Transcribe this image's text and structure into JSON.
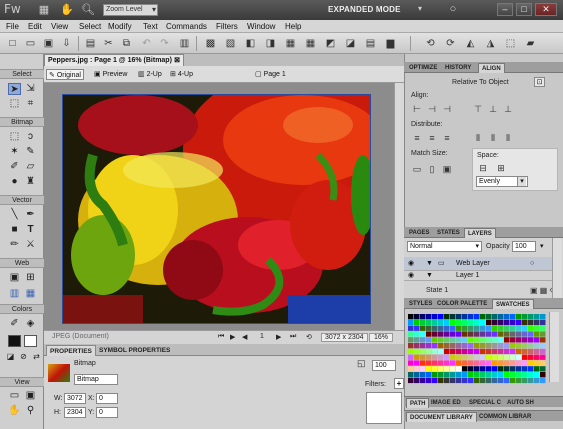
{
  "app": {
    "logo": "Fw",
    "zoom_select": "Zoom Level",
    "mode": "EXPANDED MODE"
  },
  "menu": [
    "File",
    "Edit",
    "View",
    "Select",
    "Modify",
    "Text",
    "Commands",
    "Filters",
    "Window",
    "Help"
  ],
  "document": {
    "tab_title": "Peppers.jpg : Page 1 @ 16% (Bitmap)",
    "views": {
      "original": "Original",
      "preview": "Preview",
      "two_up": "2-Up",
      "four_up": "4-Up"
    },
    "page": "Page 1"
  },
  "status": {
    "format": "JPEG (Document)",
    "page_num": "1",
    "size": "3072 x 2304",
    "zoom": "16%"
  },
  "tools": {
    "sections": [
      "Select",
      "Bitmap",
      "Vector",
      "Web",
      "Colors",
      "View"
    ]
  },
  "properties": {
    "tabs": [
      "PROPERTIES",
      "SYMBOL PROPERTIES"
    ],
    "type_label": "Bitmap",
    "name_value": "Bitmap",
    "w_label": "W:",
    "w": "3072",
    "x_label": "X:",
    "x": "0",
    "h_label": "H:",
    "h": "2304",
    "y_label": "Y:",
    "y": "0",
    "opacity": "100",
    "filters_label": "Filters:",
    "add": "+"
  },
  "right": {
    "top_tabs": [
      "OPTIMIZE",
      "HISTORY",
      "ALIGN"
    ],
    "relative": "Relative To Object",
    "align": "Align:",
    "distribute": "Distribute:",
    "match": "Match Size:",
    "space": "Space:",
    "space_select": "Evenly",
    "layer_tabs": [
      "PAGES",
      "STATES",
      "LAYERS"
    ],
    "blend": "Normal",
    "opacity_lbl": "Opacity",
    "opacity": "100",
    "layers": [
      "Web Layer",
      "Layer 1"
    ],
    "state": "State 1",
    "swatch_tabs": [
      "STYLES",
      "COLOR PALETTE",
      "SWATCHES"
    ],
    "dock_row1": [
      "PATH",
      "IMAGE ED",
      "SPECIAL C",
      "AUTO SH"
    ],
    "dock_row2": [
      "DOCUMENT LIBRARY",
      "COMMON LIBRAR"
    ]
  },
  "colors": {
    "accent": "#8fa9d8",
    "panel": "#c8c8c8",
    "selection_border": "#2c4b9a"
  }
}
